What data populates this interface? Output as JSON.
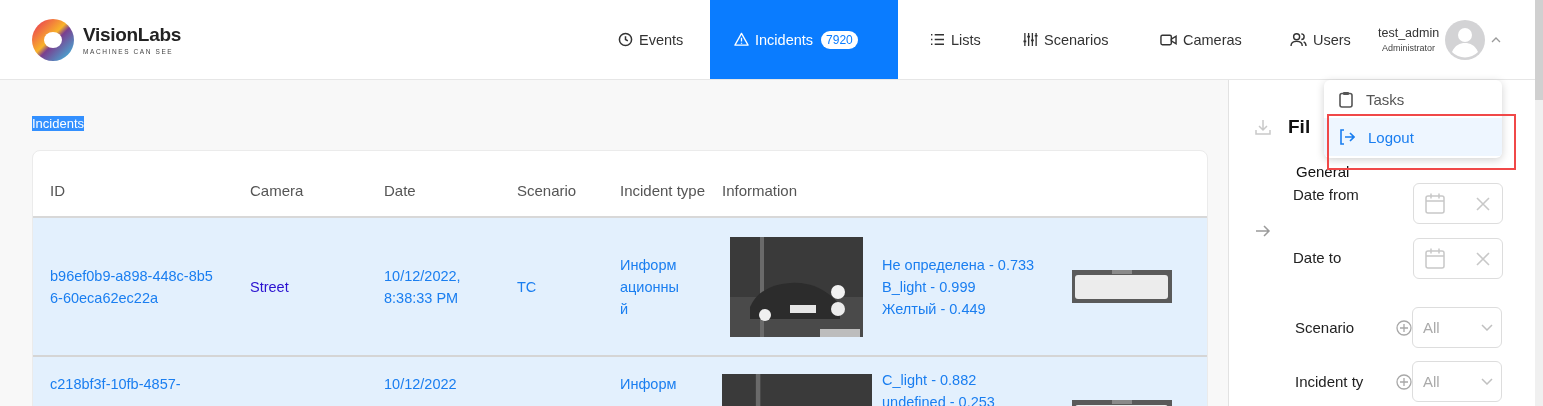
{
  "header": {
    "brand": {
      "name": "VisionLabs",
      "tagline": "MACHINES CAN SEE"
    },
    "nav": [
      {
        "label": "Events",
        "selected": false
      },
      {
        "label": "Incidents",
        "selected": true,
        "badge": "7920"
      },
      {
        "label": "Lists",
        "selected": false
      },
      {
        "label": "Scenarios",
        "selected": false
      },
      {
        "label": "Cameras",
        "selected": false
      },
      {
        "label": "Users",
        "selected": false
      }
    ],
    "user": {
      "name": "test_admin",
      "role": "Administrator",
      "expanded": true
    }
  },
  "user_menu": [
    {
      "label": "Tasks",
      "selected": false
    },
    {
      "label": "Logout",
      "selected": true
    }
  ],
  "page_title": "Incidents",
  "table": {
    "columns": [
      "ID",
      "Camera",
      "Date",
      "Scenario",
      "Incident type",
      "Information"
    ],
    "rows": [
      {
        "id": "b96ef0b9-a898-448c-8b56-60eca62ec22a",
        "camera": "Street",
        "date": "10/12/2022, 8:38:33 PM",
        "scenario": "TC",
        "incident_type": "Информационный",
        "information": [
          "Не определена - 0.733",
          "B_light - 0.999",
          "Желтый - 0.449"
        ]
      },
      {
        "id": "c218bf3f-10fb-4857-",
        "camera": "",
        "date": "10/12/2022",
        "scenario": "",
        "incident_type": "Информ",
        "information": [
          "C_light - 0.882",
          "undefined - 0.253"
        ]
      }
    ]
  },
  "filters": {
    "title": "Fil",
    "section": "General",
    "dates": [
      {
        "label": "Date from"
      },
      {
        "label": "Date to"
      }
    ],
    "selects": [
      {
        "label": "Scenario",
        "value": "All"
      },
      {
        "label": "Incident ty",
        "value": "All"
      }
    ]
  }
}
